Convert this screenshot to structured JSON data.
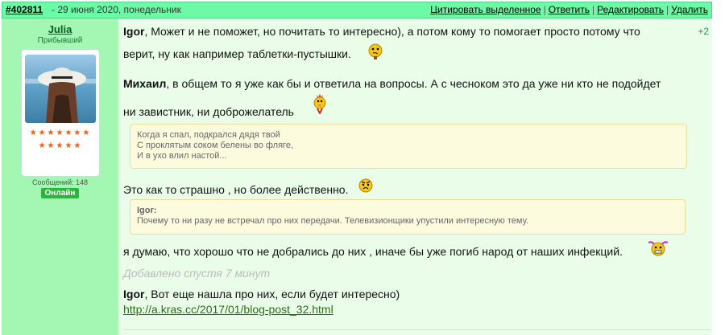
{
  "header": {
    "post_id": "#402811",
    "date": "- 29 июня 2020, понедельник",
    "actions": [
      "Цитировать выделенное",
      "Ответить",
      "Редактировать",
      "Удалить"
    ]
  },
  "user": {
    "name": "Julia",
    "role": "Прибывший",
    "stars_row1": "★★★★★★★",
    "stars_row2": "★★★★★",
    "messages": "Сообщений: 148",
    "status": "Онлайн"
  },
  "post": {
    "rating": "+2",
    "p1_name": "Igor",
    "p1_text_a": ", Может и не поможет, но почитать то интересно), а потом кому то помогает просто потому что",
    "p1_text_b": "верит, ну как например таблетки-пустышки.",
    "p2_name": "Михаил",
    "p2_text_a": ", в общем то я уже как бы и ответила на вопросы. А с чесноком это да уже ни кто не подойдет",
    "p2_text_b": "ни завистник, ни доброжелатель",
    "quote1": [
      "Когда я спал, подкрался дядя твой",
      "С проклятым соком белены во фляге,",
      "И в ухо влил настой..."
    ],
    "p3_text": "Это как то страшно , но более действенно.",
    "quote2_author": "Igor:",
    "quote2_text": "Почему то ни разу не встречал про них передачи. Телевизионщики упустили интересную тему.",
    "p4_text": "я думаю, что хорошо что не добрались до них , иначе бы уже погиб народ от наших инфекций.",
    "added_note": "Добавлено спустя 7 минут",
    "p5_name": "Igor",
    "p5_text": ", Вот еще нашла про них, если будет интересно)",
    "link": "http://a.kras.cc/2017/01/blog-post_32.html"
  }
}
